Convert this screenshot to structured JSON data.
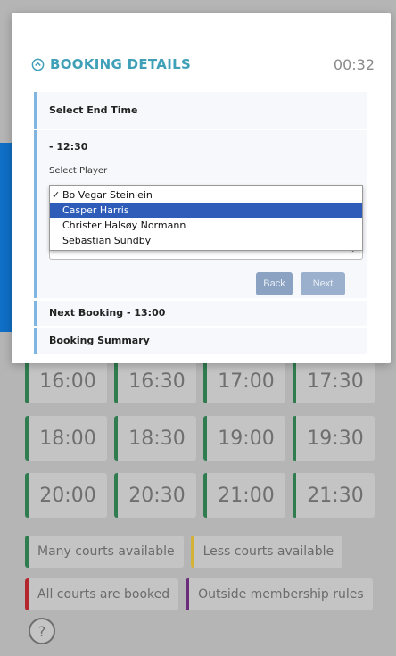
{
  "modal": {
    "title": "BOOKING DETAILS",
    "timer": "00:32",
    "steps": {
      "end_time": "Select End Time",
      "player_time": "- 12:30",
      "select_player_label": "Select Player",
      "next_booking": "Next Booking - 13:00",
      "summary": "Booking Summary"
    },
    "players": [
      "Bo Vegar Steinlein",
      "Casper Harris",
      "Christer Halsøy Normann",
      "Sebastian Sundby"
    ],
    "selected_checkmark": "✓",
    "spinner_glyph": "⇕",
    "buttons": {
      "back": "Back",
      "next": "Next"
    }
  },
  "slots": [
    "16:00",
    "16:30",
    "17:00",
    "17:30",
    "18:00",
    "18:30",
    "19:00",
    "19:30",
    "20:00",
    "20:30",
    "21:00",
    "21:30"
  ],
  "legend": {
    "many": "Many courts available",
    "less": "Less courts available",
    "booked": "All courts are booked",
    "outside": "Outside membership rules"
  },
  "help_glyph": "?",
  "colors": {
    "accent": "#3fa0b8",
    "available": "#2f7d4f",
    "less": "#d4b237",
    "booked": "#b3262e",
    "outside": "#6a2b7a",
    "selection": "#2e5cb8"
  }
}
